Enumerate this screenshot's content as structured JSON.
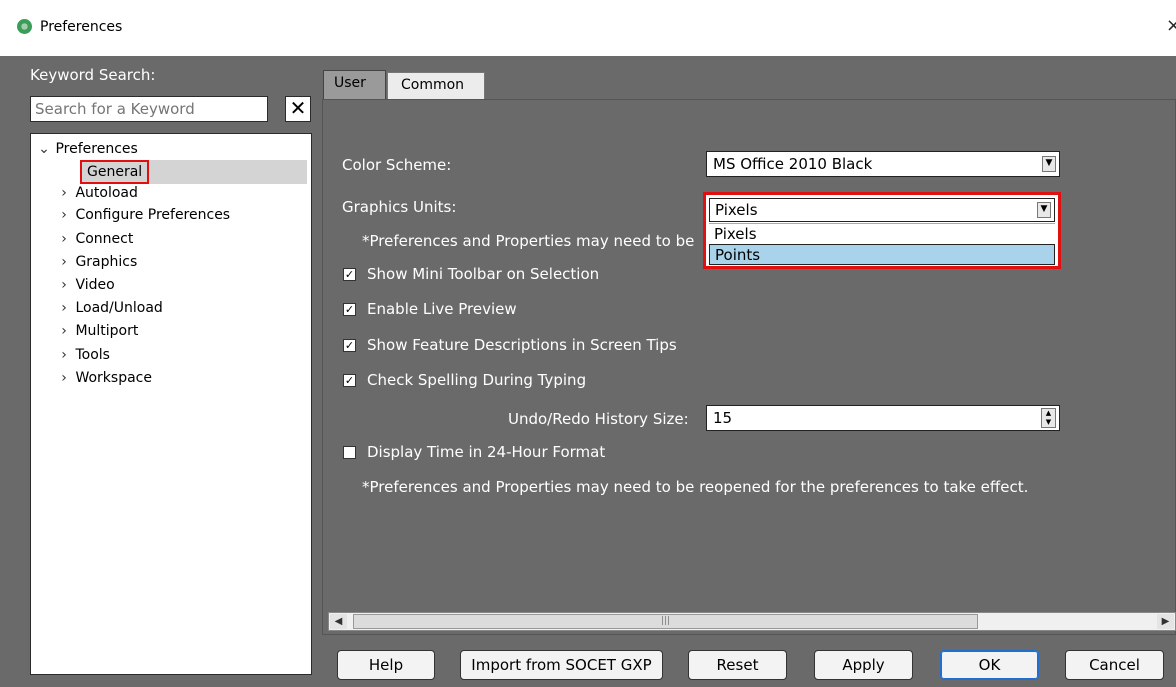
{
  "window": {
    "title": "Preferences",
    "close_glyph": "×",
    "icon": "app-logo-icon"
  },
  "sidebar": {
    "keyword_label": "Keyword Search:",
    "search_placeholder": "Search for a Keyword",
    "clear_glyph": "✕",
    "tree_root": "Preferences",
    "selected_item": "General",
    "items": [
      "Autoload",
      "Configure Preferences",
      "Connect",
      "Graphics",
      "Video",
      "Load/Unload",
      "Multiport",
      "Tools",
      "Workspace"
    ],
    "collapsed_arrow": "›",
    "expanded_arrow": "⌄"
  },
  "tabs": {
    "user": "User",
    "common": "Common",
    "active": "User"
  },
  "settings": {
    "color_scheme_label": "Color Scheme:",
    "color_scheme_value": "MS Office 2010 Black",
    "graphics_units_label": "Graphics Units:",
    "graphics_units_value": "Pixels",
    "graphics_units_options": [
      "Pixels",
      "Points"
    ],
    "graphics_units_hover": "Points",
    "note_truncated": "*Preferences and Properties may need to be",
    "show_mini_toolbar": {
      "label": "Show Mini Toolbar on Selection",
      "checked": true
    },
    "enable_live_preview": {
      "label": "Enable Live Preview",
      "checked": true
    },
    "show_feature_descriptions": {
      "label": "Show Feature Descriptions in Screen Tips",
      "checked": true
    },
    "check_spelling": {
      "label": "Check Spelling During Typing",
      "checked": true
    },
    "undo_label": "Undo/Redo History Size:",
    "undo_value": "15",
    "display_24h": {
      "label": "Display Time in 24-Hour Format",
      "checked": false
    },
    "note_full": "*Preferences and Properties may need to be reopened for the preferences to take effect."
  },
  "buttons": {
    "help": "Help",
    "import": "Import from SOCET GXP",
    "reset": "Reset",
    "apply": "Apply",
    "ok": "OK",
    "cancel": "Cancel"
  },
  "colors": {
    "background": "#6a6a6a",
    "highlight": "#e01010",
    "hover_option": "#a9d3ea",
    "ok_border": "#1f6fd0"
  }
}
